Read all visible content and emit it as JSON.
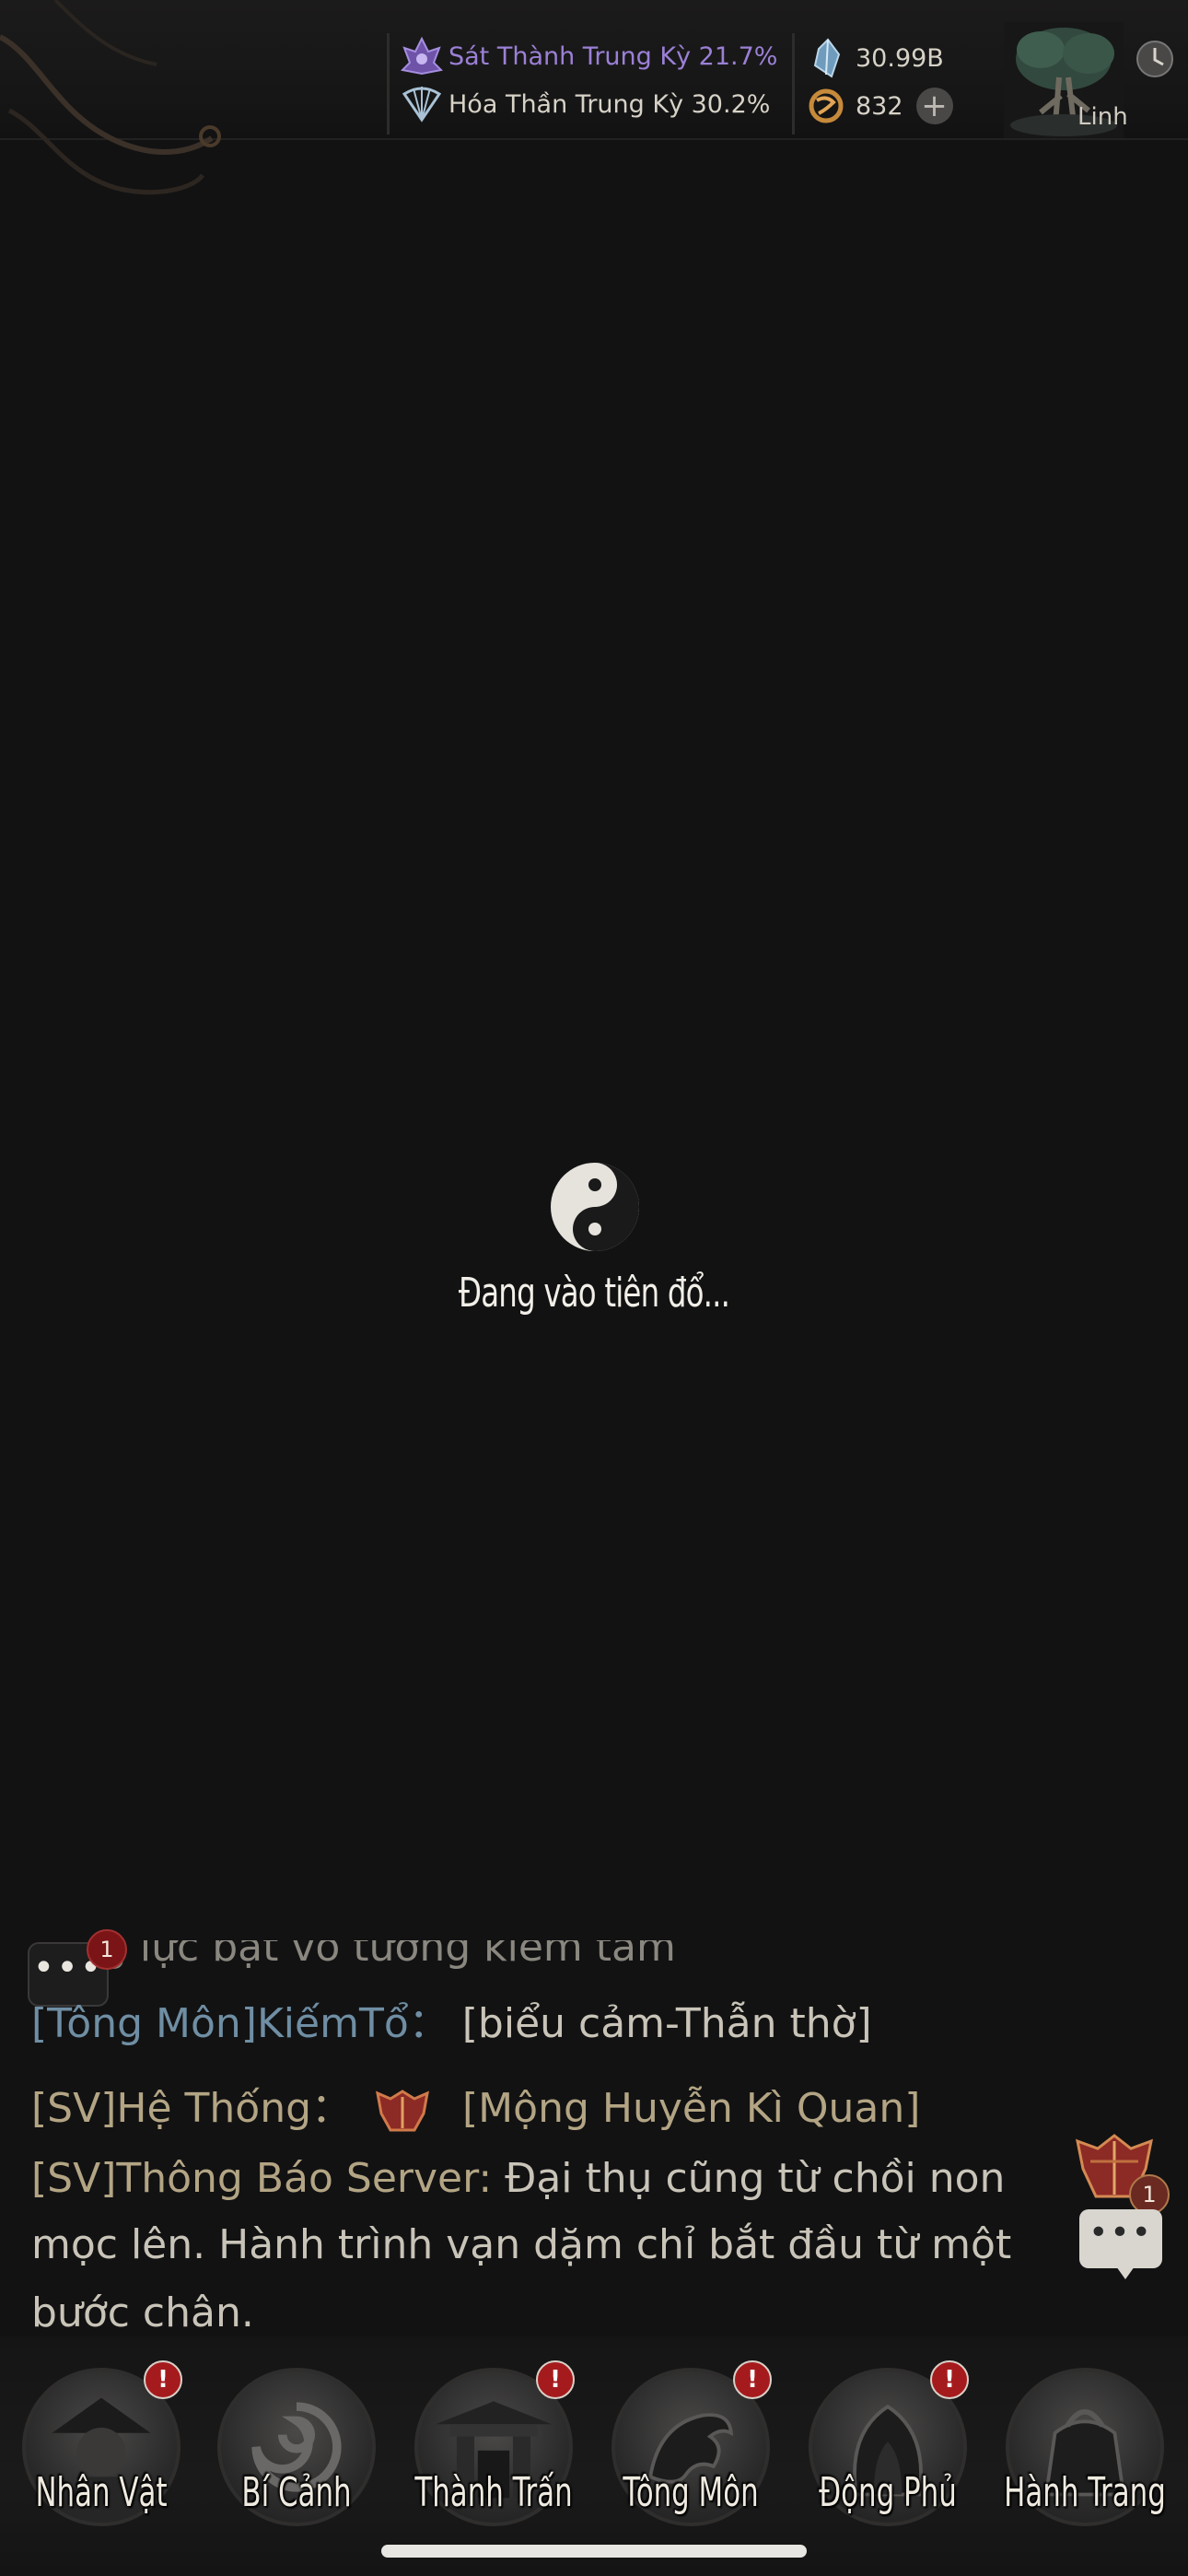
{
  "header": {
    "cultivation": [
      {
        "icon": "purple-lotus-icon",
        "label": "Sát Thành Trung Kỳ 21.7%"
      },
      {
        "icon": "fan-icon",
        "label": "Hóa Thần Trung Kỳ 30.2%"
      }
    ],
    "currency": [
      {
        "icon": "spirit-crystal-icon",
        "value": "30.99B"
      },
      {
        "icon": "copper-coin-icon",
        "value": "832"
      }
    ],
    "add_label": "+",
    "spirit_label": "Linh"
  },
  "loading": {
    "icon": "yin-yang-icon",
    "text": "Đang vào tiên đổ..."
  },
  "chat": {
    "badge_count": "1",
    "partial_line": "g lực bạt vô tướng kiếm tâm",
    "lines": [
      {
        "channel": "[Tông Môn]KiếmTổ：",
        "message": "[biểu cảm-Thẫn thờ]"
      },
      {
        "channel": "[SV]Hệ Thống：",
        "message": "[Mộng Huyễn Kì Quan]"
      },
      {
        "channel": "[SV]Thông Báo Server:",
        "message": "Đại thụ cũng từ chồi non"
      },
      {
        "message": "mọc lên. Hành trình vạn dặm chỉ bắt đầu từ một"
      },
      {
        "message": "bước chân."
      }
    ],
    "gift_badge": "1"
  },
  "nav": [
    {
      "label": "Nhân Vật",
      "icon": "character-icon",
      "alert": "!"
    },
    {
      "label": "Bí Cảnh",
      "icon": "secret-realm-icon",
      "alert": ""
    },
    {
      "label": "Thành Trấn",
      "icon": "town-gate-icon",
      "alert": "!"
    },
    {
      "label": "Tông Môn",
      "icon": "dragon-sect-icon",
      "alert": "!"
    },
    {
      "label": "Động Phủ",
      "icon": "cave-dwelling-icon",
      "alert": "!"
    },
    {
      "label": "Hành Trang",
      "icon": "bag-icon",
      "alert": ""
    }
  ]
}
